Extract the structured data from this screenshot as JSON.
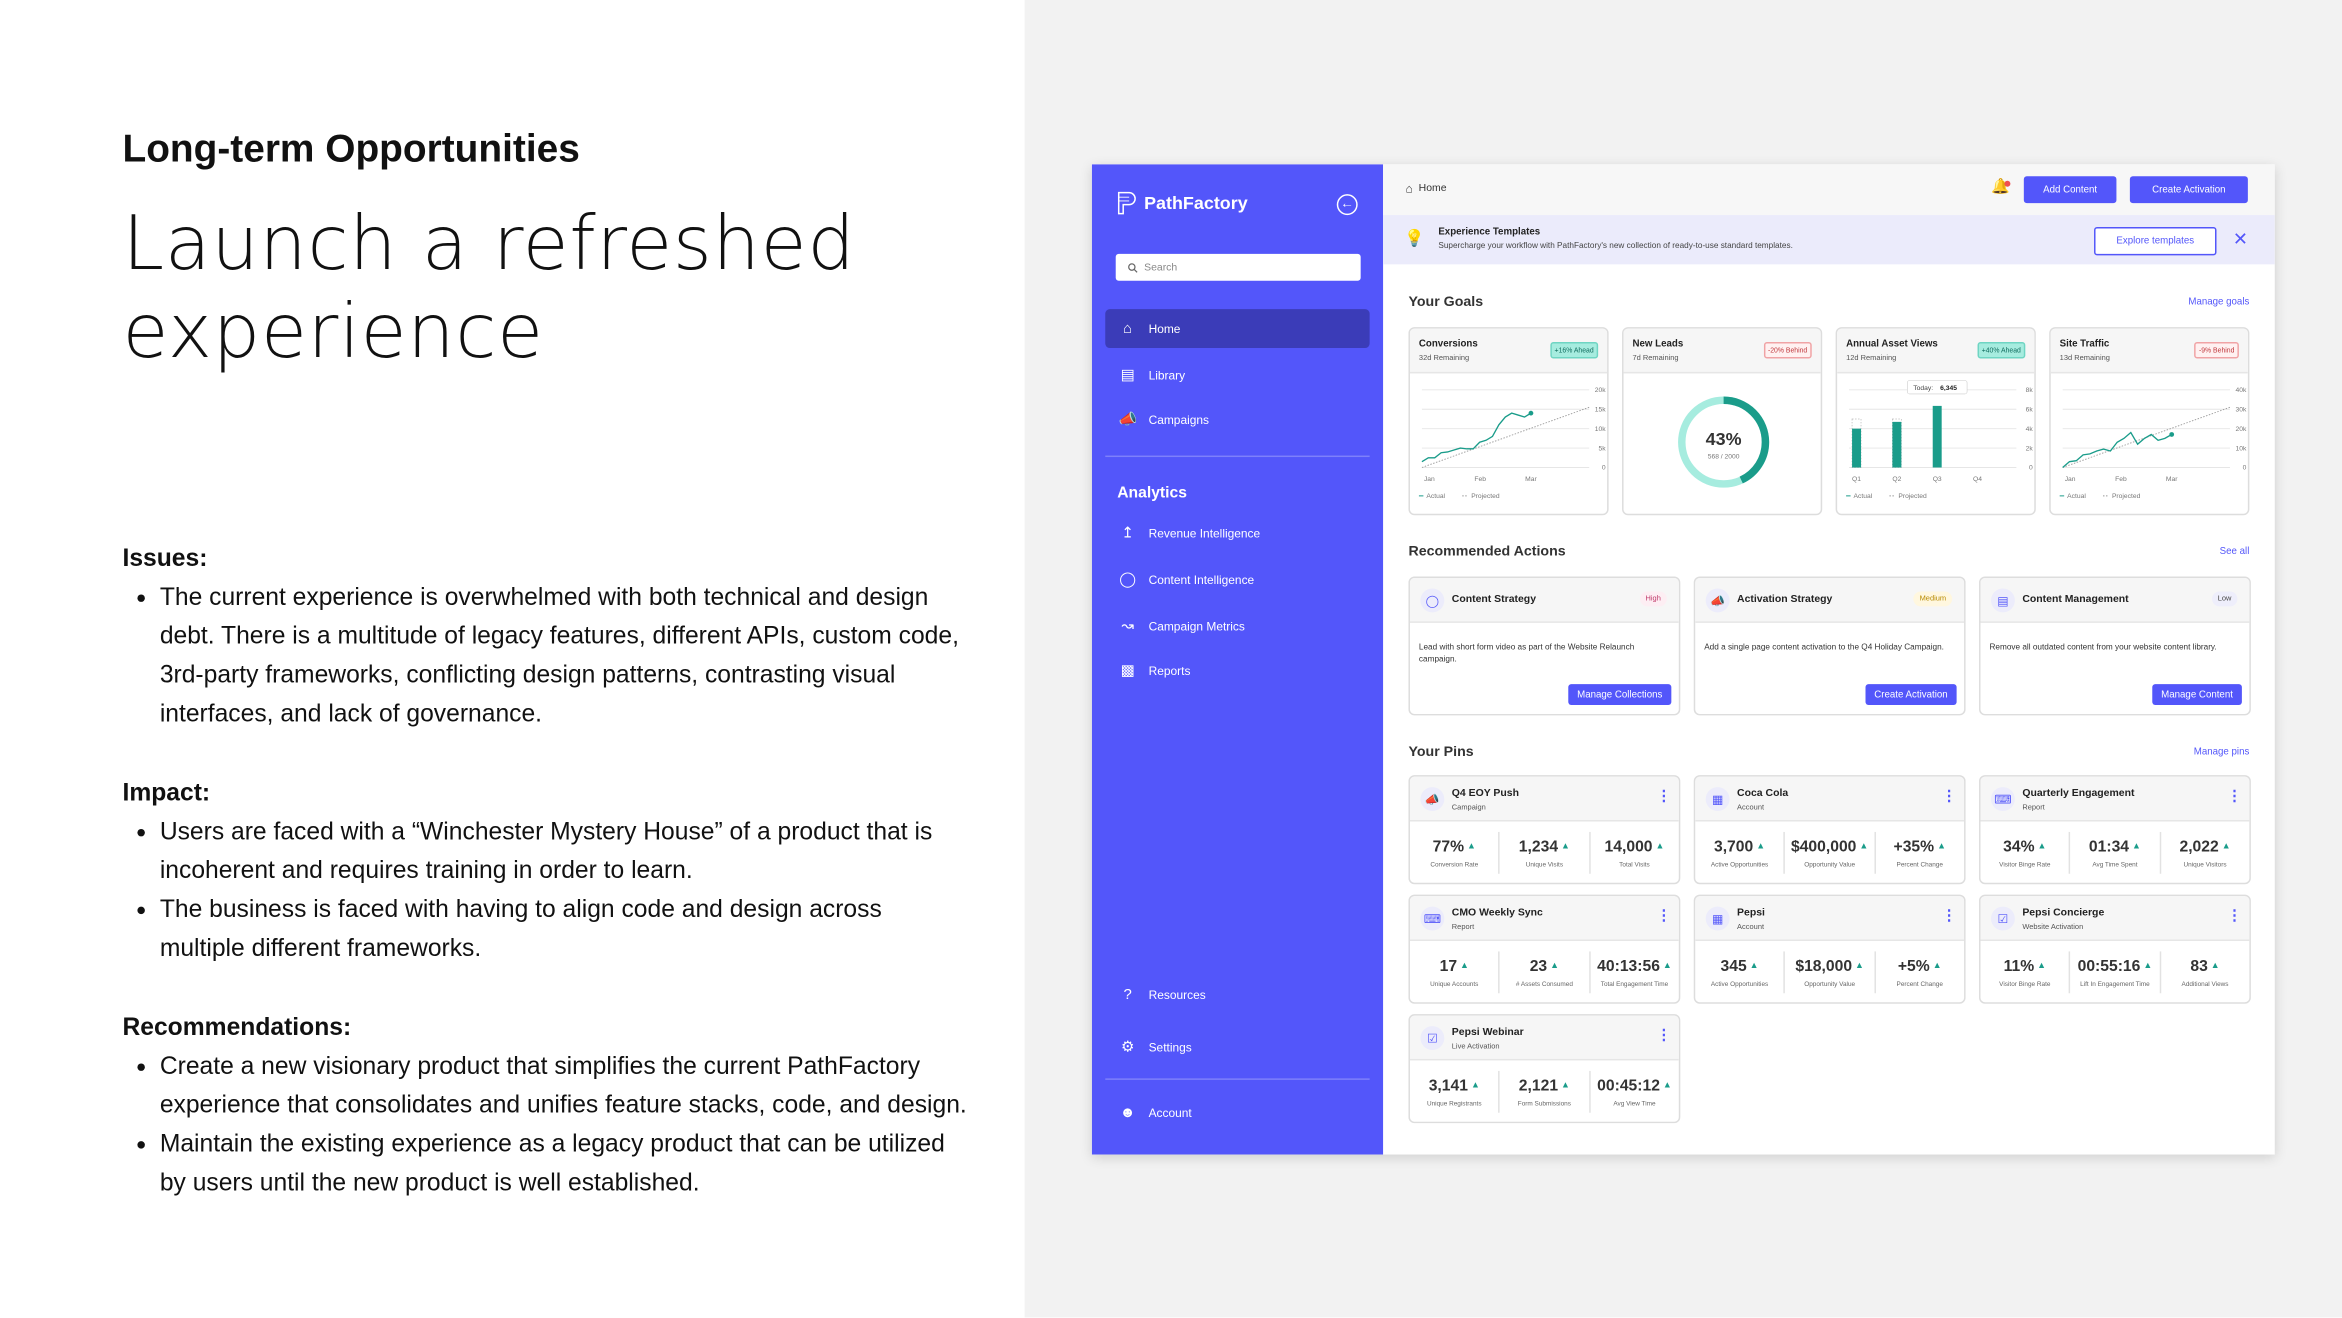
{
  "slide": {
    "kicker": "Long-term Opportunities",
    "headline": "Launch a refreshed experience",
    "sections": [
      {
        "heading": "Issues:",
        "bullets": [
          "The current experience is overwhelmed with both technical and design debt. There is a multitude of legacy features, different APIs, custom code, 3rd-party frameworks, conflicting design patterns, contrasting visual interfaces, and lack of governance."
        ]
      },
      {
        "heading": "Impact:",
        "bullets": [
          "Users are faced with a “Winchester Mystery House” of a product that is incoherent and requires training in order to learn.",
          "The business is faced with having to align code and design across multiple different frameworks."
        ]
      },
      {
        "heading": "Recommendations:",
        "bullets": [
          "Create a new visionary product that simplifies the current PathFactory experience that consolidates and unifies feature stacks, code, and design.",
          "Maintain the existing experience as a legacy product that can be utilized by users until the new product is well established."
        ]
      }
    ]
  },
  "colors": {
    "accent": "#5356fa",
    "sidebar_active": "#3b3cb8",
    "teal": "#1a9c8a",
    "teal_light": "#a6ecdf",
    "behind": "#c0393d"
  },
  "sidebar": {
    "brand": "PathFactory",
    "search_placeholder": "Search",
    "items": [
      {
        "label": "Home",
        "icon": "home-icon",
        "active": true
      },
      {
        "label": "Library",
        "icon": "library-icon"
      },
      {
        "label": "Campaigns",
        "icon": "megaphone-icon"
      }
    ],
    "analytics_heading": "Analytics",
    "analytics_items": [
      {
        "label": "Revenue Intelligence",
        "icon": "trend-chart-icon"
      },
      {
        "label": "Content Intelligence",
        "icon": "ring-icon"
      },
      {
        "label": "Campaign Metrics",
        "icon": "metrics-icon"
      },
      {
        "label": "Reports",
        "icon": "bar-chart-icon"
      }
    ],
    "bottom_items": [
      {
        "label": "Resources",
        "icon": "help-icon"
      },
      {
        "label": "Settings",
        "icon": "gear-icon"
      },
      {
        "label": "Account",
        "icon": "user-icon"
      }
    ]
  },
  "header": {
    "breadcrumb": "Home",
    "add_content": "Add Content",
    "create_activation": "Create Activation"
  },
  "banner": {
    "title": "Experience Templates",
    "text": "Supercharge your workflow with PathFactory's new collection of ready-to-use standard templates.",
    "button": "Explore templates"
  },
  "goals": {
    "heading": "Your Goals",
    "link": "Manage goals",
    "cards": [
      {
        "title": "Conversions",
        "remaining": "32d Remaining",
        "badge": "+16% Ahead",
        "status": "ahead"
      },
      {
        "title": "New Leads",
        "remaining": "7d Remaining",
        "badge": "-20% Behind",
        "status": "behind"
      },
      {
        "title": "Annual Asset Views",
        "remaining": "12d Remaining",
        "badge": "+40% Ahead",
        "status": "ahead"
      },
      {
        "title": "Site Traffic",
        "remaining": "13d Remaining",
        "badge": "-9% Behind",
        "status": "behind"
      }
    ]
  },
  "chart_data": [
    {
      "type": "line",
      "x_ticks": [
        "Jan",
        "Feb",
        "Mar"
      ],
      "y_ticks": [
        "0",
        "5k",
        "10k",
        "15k",
        "20k"
      ],
      "ylim": [
        0,
        20000
      ],
      "grid": true,
      "legend": [
        "Actual",
        "Projected"
      ],
      "legend_placement": "bottom-left",
      "series": [
        {
          "name": "Actual",
          "values": [
            1500,
            2500,
            2500,
            3800,
            4000,
            4500,
            5000,
            4800,
            4800,
            6500,
            7000,
            8000,
            11000,
            13000,
            14000,
            13500,
            13000,
            14000
          ]
        },
        {
          "name": "Projected",
          "values": [
            0,
            15500
          ]
        }
      ]
    },
    {
      "type": "pie",
      "percent": 43,
      "value_label": "43%",
      "sub_label": "568 / 2000",
      "value": 568,
      "total": 2000
    },
    {
      "type": "bar",
      "categories": [
        "Q1",
        "Q2",
        "Q3",
        "Q4"
      ],
      "y_ticks": [
        "0",
        "2k",
        "4k",
        "6k",
        "8k"
      ],
      "ylim": [
        0,
        8000
      ],
      "grid": true,
      "legend": [
        "Actual",
        "Projected"
      ],
      "legend_placement": "bottom-left",
      "series": [
        {
          "name": "Actual",
          "values": [
            4000,
            4700,
            6345,
            null
          ]
        },
        {
          "name": "Projected",
          "values": [
            5000,
            5000,
            null,
            null
          ]
        }
      ],
      "tooltip": {
        "label": "Today:",
        "value": "6,345"
      }
    },
    {
      "type": "line",
      "x_ticks": [
        "Jan",
        "Feb",
        "Mar"
      ],
      "y_ticks": [
        "0",
        "10k",
        "20k",
        "30k",
        "40k"
      ],
      "ylim": [
        0,
        40000
      ],
      "grid": true,
      "legend": [
        "Actual",
        "Projected"
      ],
      "legend_placement": "bottom-left",
      "series": [
        {
          "name": "Actual",
          "values": [
            0,
            3000,
            3500,
            6500,
            7000,
            8500,
            9500,
            8500,
            13000,
            15000,
            18000,
            12000,
            15000,
            17000,
            14000,
            15000,
            17000
          ]
        },
        {
          "name": "Projected",
          "values": [
            0,
            31000
          ]
        }
      ]
    }
  ],
  "actions": {
    "heading": "Recommended Actions",
    "link": "See all",
    "cards": [
      {
        "title": "Content Strategy",
        "icon": "ring-icon",
        "priority": "High",
        "priority_color": "#c0396a",
        "desc": "Lead with short form video as part of the Website Relaunch campaign.",
        "button": "Manage Collections"
      },
      {
        "title": "Activation Strategy",
        "icon": "megaphone-icon",
        "priority": "Medium",
        "priority_color": "#b88a00",
        "desc": "Add a single page content activation to the Q4 Holiday Campaign.",
        "button": "Create Activation"
      },
      {
        "title": "Content Management",
        "icon": "document-icon",
        "priority": "Low",
        "priority_color": "#444",
        "desc": "Remove all outdated content from your website content library.",
        "button": "Manage Content"
      }
    ]
  },
  "pins": {
    "heading": "Your Pins",
    "link": "Manage pins",
    "cards": [
      {
        "title": "Q4 EOY Push",
        "type": "Campaign",
        "icon": "megaphone-icon",
        "stats": [
          {
            "v": "77%",
            "l": "Conversion Rate"
          },
          {
            "v": "1,234",
            "l": "Unique Visits"
          },
          {
            "v": "14,000",
            "l": "Total Visits"
          }
        ]
      },
      {
        "title": "Coca Cola",
        "type": "Account",
        "icon": "building-icon",
        "stats": [
          {
            "v": "3,700",
            "l": "Active Opportunities"
          },
          {
            "v": "$400,000",
            "l": "Opportunity Value"
          },
          {
            "v": "+35%",
            "l": "Percent Change"
          }
        ]
      },
      {
        "title": "Quarterly Engagement",
        "type": "Report",
        "icon": "clipboard-icon",
        "stats": [
          {
            "v": "34%",
            "l": "Visitor Binge Rate"
          },
          {
            "v": "01:34",
            "l": "Avg Time Spent"
          },
          {
            "v": "2,022",
            "l": "Unique Visitors"
          }
        ]
      },
      {
        "title": "CMO Weekly Sync",
        "type": "Report",
        "icon": "clipboard-icon",
        "stats": [
          {
            "v": "17",
            "l": "Unique Accounts"
          },
          {
            "v": "23",
            "l": "# Assets Consumed"
          },
          {
            "v": "40:13:56",
            "l": "Total Engagement Time"
          }
        ]
      },
      {
        "title": "Pepsi",
        "type": "Account",
        "icon": "building-icon",
        "stats": [
          {
            "v": "345",
            "l": "Active Opportunities"
          },
          {
            "v": "$18,000",
            "l": "Opportunity Value"
          },
          {
            "v": "+5%",
            "l": "Percent Change"
          }
        ]
      },
      {
        "title": "Pepsi Concierge",
        "type": "Website Activation",
        "icon": "activation-icon",
        "stats": [
          {
            "v": "11%",
            "l": "Visitor Binge Rate"
          },
          {
            "v": "00:55:16",
            "l": "Lift In Engagement Time"
          },
          {
            "v": "83",
            "l": "Additional Views"
          }
        ]
      },
      {
        "title": "Pepsi Webinar",
        "type": "Live Activation",
        "icon": "activation-icon",
        "stats": [
          {
            "v": "3,141",
            "l": "Unique Registrants"
          },
          {
            "v": "2,121",
            "l": "Form Submissions"
          },
          {
            "v": "00:45:12",
            "l": "Avg View Time"
          }
        ]
      }
    ]
  }
}
